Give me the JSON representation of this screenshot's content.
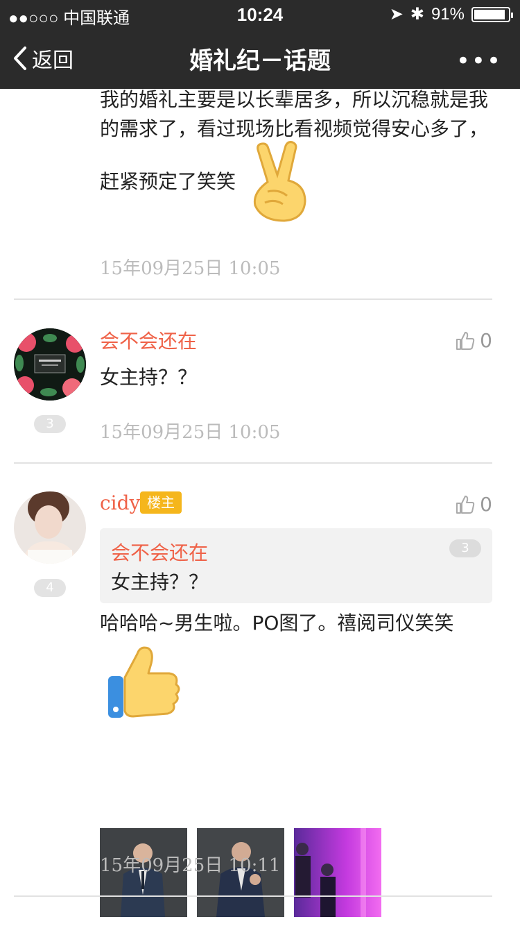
{
  "status_bar": {
    "carrier": "●●○○○ 中国联通",
    "time": "10:24",
    "battery_text": "91%",
    "battery_level": 0.91
  },
  "nav": {
    "back_label": "返回",
    "title": "婚礼纪－话题",
    "more_label": "•••"
  },
  "top_post": {
    "text_lines": [
      "我的婚礼主要是以长辈居多，所以沉稳就是我",
      "的需求了，看过现场比看视频觉得安心多了，",
      "赶紧预定了笑笑"
    ],
    "time": "15年09月25日 10:05"
  },
  "comments": [
    {
      "name": "会不会还在",
      "floor": "3",
      "likes": "0",
      "text": "女主持？？",
      "time": "15年09月25日 10:05"
    },
    {
      "name": "cidy",
      "badge": "楼主",
      "floor": "4",
      "likes": "0",
      "quote": {
        "name": "会不会还在",
        "floor": "3",
        "text": "女主持？？"
      },
      "text": "哈哈哈~男生啦。PO图了。禧阅司仪笑笑",
      "time": "15年09月25日 10:11"
    }
  ],
  "colors": {
    "accent": "#ef6248",
    "badge": "#f5b61c",
    "nav_bg": "#2b2b2b"
  }
}
